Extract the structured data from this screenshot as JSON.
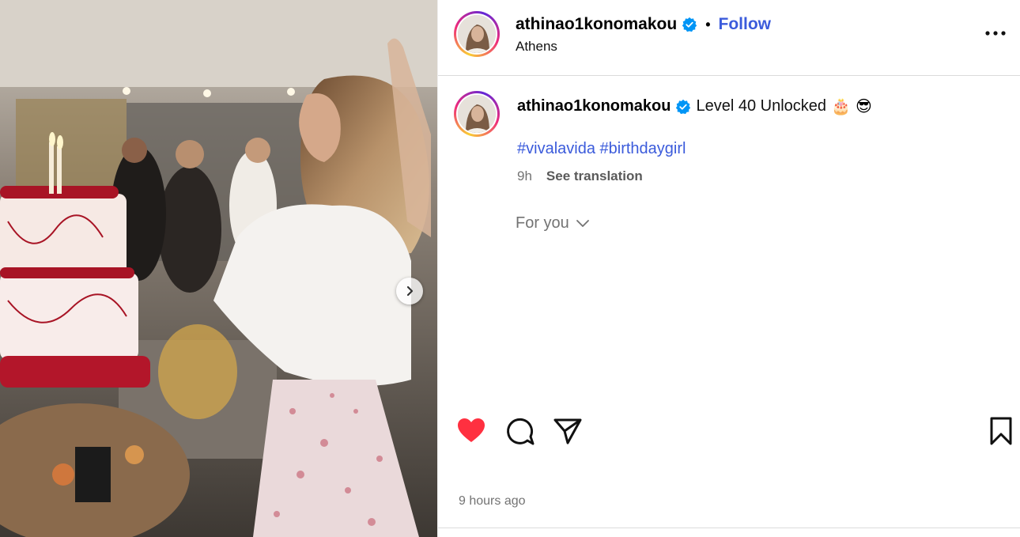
{
  "post": {
    "username": "athinao1konomakou",
    "location": "Athens",
    "follow_label": "Follow",
    "separator": "•",
    "caption": "Level 40 Unlocked",
    "caption_emojis": [
      "🎂",
      "😎"
    ],
    "hashtags": [
      "#vivalavida",
      "#birthdaygirl"
    ],
    "age_short": "9h",
    "see_translation": "See translation",
    "for_you": "For you",
    "time_ago": "9 hours ago",
    "liked": true
  },
  "colors": {
    "link_blue": "#3b5bdb",
    "like_red": "#ff3040",
    "verified_blue": "#0095f6"
  },
  "icons": {
    "verified": "verified-badge-icon",
    "more": "more-options-icon",
    "next": "chevron-right-icon",
    "like": "heart-icon",
    "comment": "comment-icon",
    "share": "share-icon",
    "save": "bookmark-icon",
    "chevron": "chevron-down-icon"
  }
}
